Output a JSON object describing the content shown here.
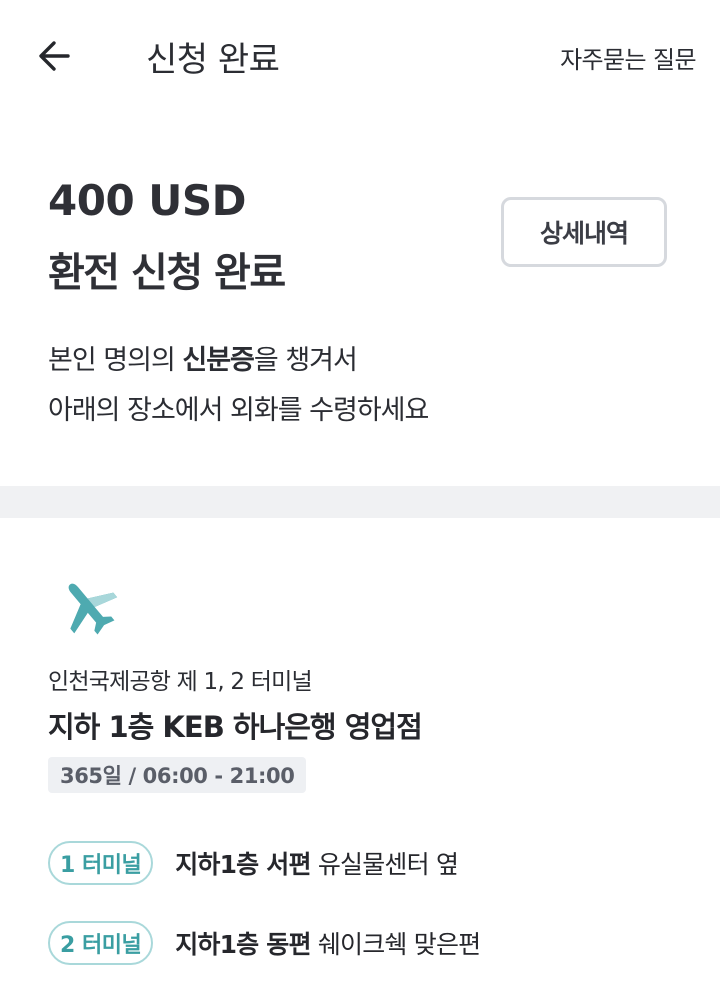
{
  "header": {
    "title": "신청 완료",
    "faq_label": "자주묻는 질문"
  },
  "summary": {
    "amount": "400 USD",
    "status": "환전 신청 완료",
    "detail_button": "상세내역"
  },
  "instruction": {
    "line1_prefix": "본인 명의의 ",
    "line1_bold": "신분증",
    "line1_suffix": "을 챙겨서",
    "line2": "아래의 장소에서 외화를 수령하세요"
  },
  "location": {
    "icon": "airplane-icon",
    "airport": "인천국제공항 제 1, 2 터미널",
    "branch": "지하 1층 KEB 하나은행 영업점",
    "hours": "365일 / 06:00 - 21:00",
    "terminals": [
      {
        "label": "1 터미널",
        "location_bold": "지하1층 서편",
        "location_rest": " 유실물센터 옆"
      },
      {
        "label": "2 터미널",
        "location_bold": "지하1층 동편",
        "location_rest": " 쉐이크쉑 맞은편"
      }
    ]
  },
  "colors": {
    "accent_teal": "#3a9ea2",
    "plane_teal": "#4eaab0",
    "divider": "#f0f1f3"
  }
}
